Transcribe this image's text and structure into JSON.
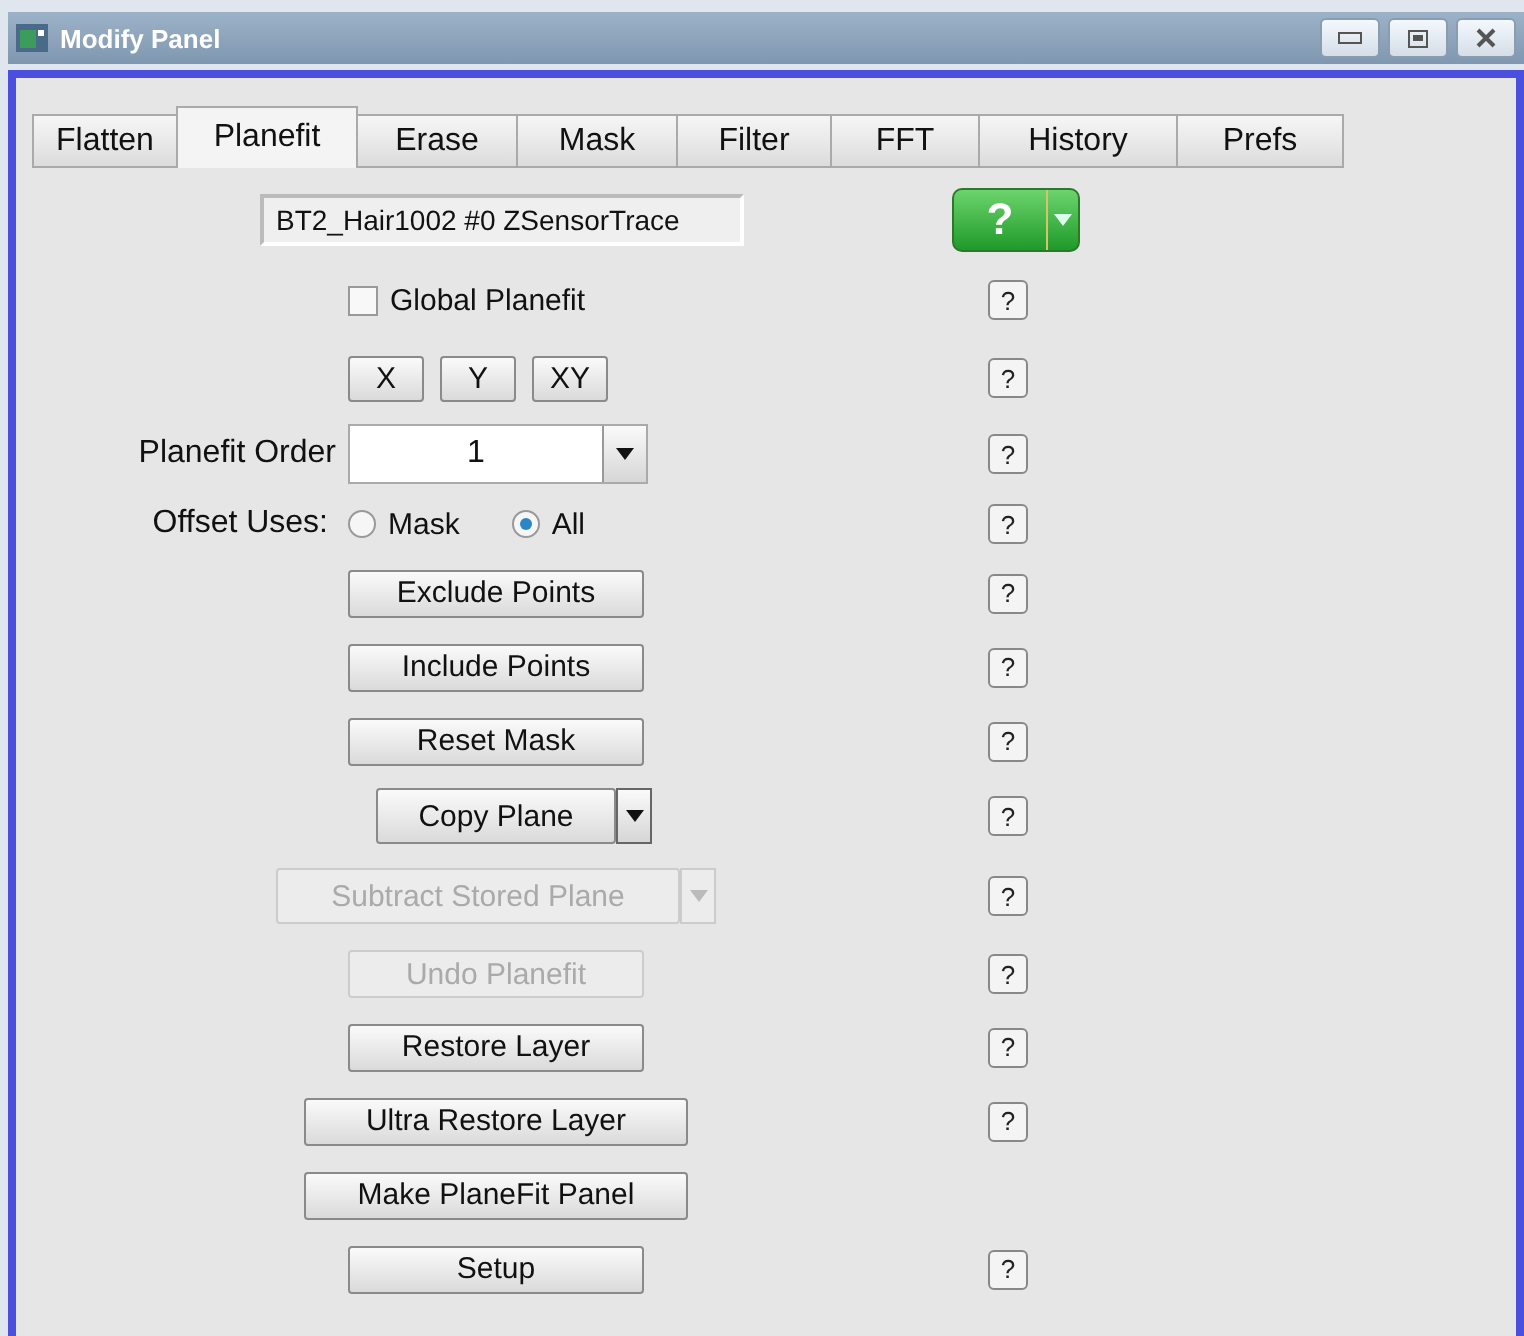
{
  "window": {
    "title": "Modify Panel"
  },
  "tabs": [
    {
      "label": "Flatten",
      "selected": false
    },
    {
      "label": "Planefit",
      "selected": true
    },
    {
      "label": "Erase",
      "selected": false
    },
    {
      "label": "Mask",
      "selected": false
    },
    {
      "label": "Filter",
      "selected": false
    },
    {
      "label": "FFT",
      "selected": false
    },
    {
      "label": "History",
      "selected": false
    },
    {
      "label": "Prefs",
      "selected": false
    }
  ],
  "rows": [
    {
      "kind": "field",
      "value": "BT2_Hair1002 #0 ZSensorTrace",
      "help": {
        "kind": "green",
        "label": "?"
      }
    },
    {
      "kind": "checkbox",
      "label": "Global Planefit",
      "checked": false,
      "help": {
        "kind": "small",
        "label": "?"
      }
    },
    {
      "kind": "axes",
      "buttons": [
        "X",
        "Y",
        "XY"
      ],
      "help": {
        "kind": "small",
        "label": "?"
      }
    },
    {
      "kind": "combo",
      "label": "Planefit Order",
      "value": "1",
      "help": {
        "kind": "small",
        "label": "?"
      }
    },
    {
      "kind": "radio",
      "label": "Offset Uses:",
      "options": [
        {
          "label": "Mask",
          "selected": false
        },
        {
          "label": "All",
          "selected": true
        }
      ],
      "help": {
        "kind": "small",
        "label": "?"
      }
    },
    {
      "kind": "button",
      "label": "Exclude Points",
      "disabled": false,
      "wide": false,
      "help": {
        "kind": "small",
        "label": "?"
      }
    },
    {
      "kind": "button",
      "label": "Include Points",
      "disabled": false,
      "wide": false,
      "help": {
        "kind": "small",
        "label": "?"
      }
    },
    {
      "kind": "button",
      "label": "Reset Mask",
      "disabled": false,
      "wide": false,
      "help": {
        "kind": "small",
        "label": "?"
      }
    },
    {
      "kind": "split",
      "label": "Copy Plane",
      "disabled": false,
      "help": {
        "kind": "small",
        "label": "?"
      }
    },
    {
      "kind": "split",
      "label": "Subtract Stored Plane",
      "disabled": true,
      "help": {
        "kind": "small",
        "label": "?"
      }
    },
    {
      "kind": "button",
      "label": "Undo Planefit",
      "disabled": true,
      "wide": false,
      "help": {
        "kind": "small",
        "label": "?"
      }
    },
    {
      "kind": "button",
      "label": "Restore Layer",
      "disabled": false,
      "wide": false,
      "help": {
        "kind": "small",
        "label": "?"
      }
    },
    {
      "kind": "button",
      "label": "Ultra Restore Layer",
      "disabled": false,
      "wide": true,
      "help": {
        "kind": "small",
        "label": "?"
      }
    },
    {
      "kind": "button",
      "label": "Make PlaneFit Panel",
      "disabled": false,
      "wide": true
    },
    {
      "kind": "button",
      "label": "Setup",
      "disabled": false,
      "wide": false,
      "help": {
        "kind": "small",
        "label": "?"
      }
    }
  ]
}
